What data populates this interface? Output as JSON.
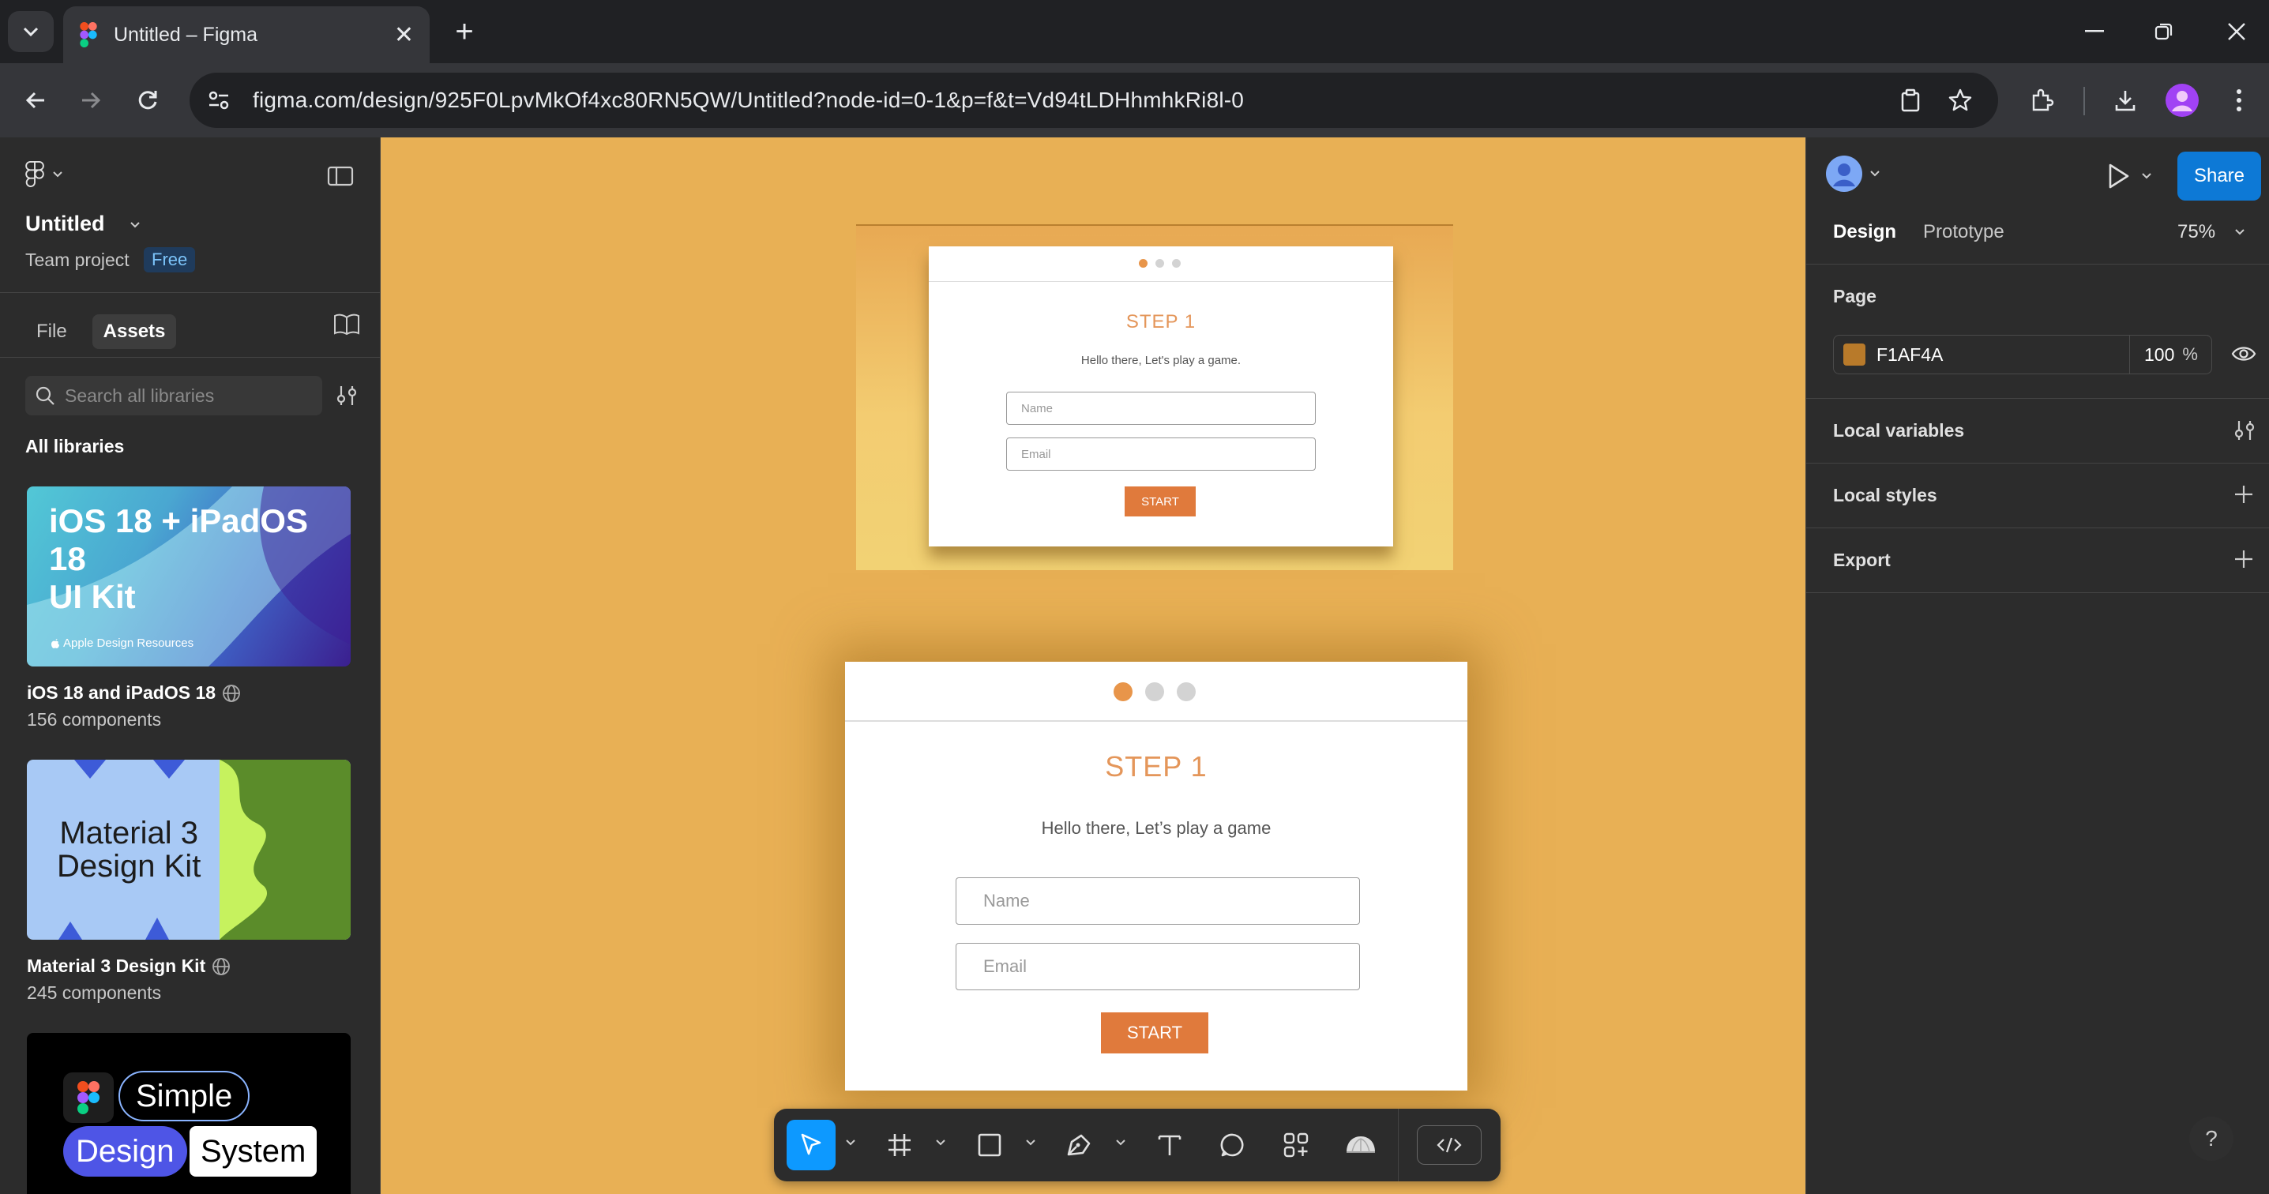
{
  "browser": {
    "tab_title": "Untitled – Figma",
    "url": "figma.com/design/925F0LpvMkOf4xc80RN5QW/Untitled?node-id=0-1&p=f&t=Vd94tLDHhmhkRi8l-0",
    "new_tab": "+",
    "close_tab": "✕"
  },
  "left_panel": {
    "file_name": "Untitled",
    "team": "Team project",
    "plan_badge": "Free",
    "tabs": [
      "File",
      "Assets"
    ],
    "active_tab": "Assets",
    "search_placeholder": "Search all libraries",
    "section_label": "All libraries",
    "libraries": [
      {
        "name": "iOS 18 and iPadOS 18",
        "count": "156 components",
        "thumb_title": "iOS 18 + iPadOS 18 UI Kit",
        "thumb_line1": "iOS 18 + iPadOS 18",
        "thumb_line2": "UI Kit",
        "thumb_caption": "Apple Design Resources"
      },
      {
        "name": "Material 3 Design Kit",
        "count": "245 components",
        "thumb_line1": "Material 3",
        "thumb_line2": "Design Kit"
      },
      {
        "thumb_word1": "Simple",
        "thumb_word2": "Design",
        "thumb_word3": "System"
      }
    ]
  },
  "canvas": {
    "background": "#E8B055",
    "small_frame": {
      "step": "STEP 1",
      "greeting": "Hello there, Let's play a game.",
      "name_placeholder": "Name",
      "email_placeholder": "Email",
      "button": "START"
    },
    "large_frame": {
      "step": "STEP 1",
      "greeting": "Hello there, Let’s play a game",
      "name_placeholder": "Name",
      "email_placeholder": "Email",
      "button": "START"
    }
  },
  "toolbar": {
    "tools": [
      "move-tool",
      "frame-tool",
      "shape-tool",
      "pen-tool",
      "text-tool",
      "comment-tool",
      "actions-tool",
      "dev-mode"
    ]
  },
  "right_panel": {
    "share": "Share",
    "tabs": [
      "Design",
      "Prototype"
    ],
    "active_tab": "Design",
    "zoom": "75%",
    "page_label": "Page",
    "page_color_hex": "F1AF4A",
    "page_color_swatch": "#B87A2A",
    "page_opacity": "100",
    "page_opacity_unit": "%",
    "local_variables": "Local variables",
    "local_styles": "Local styles",
    "export": "Export"
  },
  "colors": {
    "accent": "#0D99FF",
    "share": "#0D79D6",
    "step_orange": "#E4965A",
    "start_button": "#E07A3C"
  }
}
